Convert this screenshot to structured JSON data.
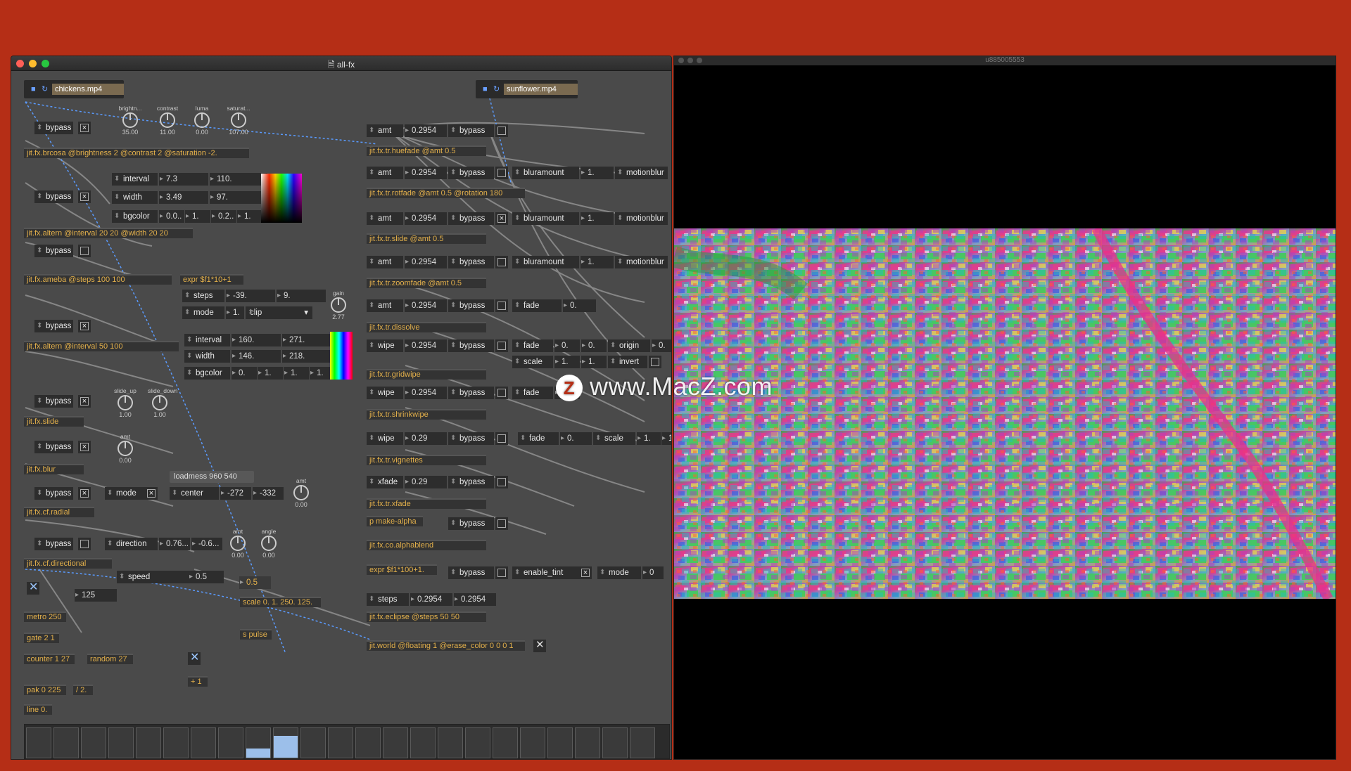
{
  "patcher": {
    "title": "all-fx",
    "players": [
      "chickens.mp4",
      "sunflower.mp4"
    ],
    "knobs": [
      {
        "label": "brightn...",
        "value": "35.00"
      },
      {
        "label": "contrast",
        "value": "11.00"
      },
      {
        "label": "luma",
        "value": "0.00"
      },
      {
        "label": "saturat...",
        "value": "107.00"
      },
      {
        "label": "gain",
        "value": "2.77"
      },
      {
        "label": "slide_up",
        "value": "1.00"
      },
      {
        "label": "slide_down",
        "value": "1.00"
      },
      {
        "label": "amt",
        "value": "0.00"
      },
      {
        "label": "amt",
        "value": "0.00"
      },
      {
        "label": "amt",
        "value": "0.00"
      },
      {
        "label": "angle",
        "value": "0.00"
      }
    ],
    "objects": {
      "brcosa": "jit.fx.brcosa @brightness 2 @contrast 2 @saturation -2.",
      "altern1": "jit.fx.altern @interval 20 20 @width 20 20",
      "ameba": "jit.fx.ameba @steps 100 100",
      "expr1": "expr $f1*10+1",
      "altern2": "jit.fx.altern @interval 50 100",
      "slide": "jit.fx.slide",
      "blur": "jit.fx.blur",
      "radial": "jit.fx.cf.radial",
      "directional": "jit.fx.cf.directional",
      "metro": "metro 250",
      "gate": "gate 2 1",
      "counter": "counter 1 27",
      "random": "random 27",
      "pak": "pak 0 225",
      "div": "/ 2.",
      "line": "line 0.",
      "plus": "+ 1",
      "scale": "scale 0. 1. 250. 125.",
      "spulse": "s pulse",
      "huefade": "jit.fx.tr.huefade @amt 0.5",
      "rotfade": "jit.fx.tr.rotfade @amt 0.5 @rotation 180",
      "trslide": "jit.fx.tr.slide @amt 0.5",
      "zoomfade": "jit.fx.tr.zoomfade @amt 0.5",
      "dissolve": "jit.fx.tr.dissolve",
      "gridwipe": "jit.fx.tr.gridwipe",
      "shrinkwipe": "jit.fx.tr.shrinkwipe",
      "vignettes": "jit.fx.tr.vignettes",
      "xfade": "jit.fx.tr.xfade",
      "makealpha": "p make-alpha",
      "alphablend": "jit.fx.co.alphablend",
      "expr2": "expr $f1*100+1.",
      "eclipse": "jit.fx.eclipse @steps 50 50",
      "world": "jit.world @floating 1 @erase_color 0 0 0 1"
    },
    "messages": {
      "loadmess": "loadmess 960 540"
    },
    "labels": {
      "bypass": "bypass",
      "interval": "interval",
      "width": "width",
      "bgcolor": "bgcolor",
      "steps": "steps",
      "mode": "mode",
      "center": "center",
      "direction": "direction",
      "speed": "speed",
      "amt": "amt",
      "bluramount": "bluramount",
      "motionblur": "motionblur",
      "fade": "fade",
      "wipe": "wipe",
      "origin": "origin",
      "scale": "scale",
      "invert": "invert",
      "xfade": "xfade",
      "enable_tint": "enable_tint",
      "clip": "clip"
    },
    "values": {
      "interval1": [
        "7.3",
        "110."
      ],
      "width1": [
        "3.49",
        "97."
      ],
      "bgcolor1": [
        "0.0..",
        "1.",
        "0.2..",
        "1."
      ],
      "steps": [
        "-39.",
        "9."
      ],
      "mode1": "1.",
      "interval2": [
        "160.",
        "271."
      ],
      "width2": [
        "146.",
        "218."
      ],
      "bgcolor2": [
        "0.",
        "1.",
        "1.",
        "1."
      ],
      "center": [
        "-272",
        "-332"
      ],
      "direction": [
        "0.76...",
        "-0.6..."
      ],
      "speed": "0.5",
      "num125": "125",
      "num05": "0.5",
      "amt": "0.2954",
      "blur": "1.",
      "fade": "0.",
      "fade_b": "0.",
      "origin": "0.",
      "scale": [
        "1.",
        "1."
      ],
      "wipe029": "0.29",
      "vfade": "0.",
      "vscale": "1.",
      "vscale2": "1",
      "xfade": "0.29",
      "tintmode": "0"
    },
    "multislider": [
      0,
      0,
      0,
      0,
      0,
      0,
      0,
      0,
      0.3,
      0.75,
      0,
      0,
      0,
      0,
      0,
      0,
      0,
      0,
      0,
      0,
      0,
      0,
      0
    ]
  },
  "viewer": {
    "title": "u885005553"
  },
  "watermark": "www.MacZ.com",
  "colors": {
    "background": "#b52e16",
    "patcher": "#4a4a4a",
    "object_text": "#e3b04b",
    "attr_text": "#9cc7ff",
    "cable": "#9a9a9a",
    "patch_cord": "#6aa0ff"
  }
}
